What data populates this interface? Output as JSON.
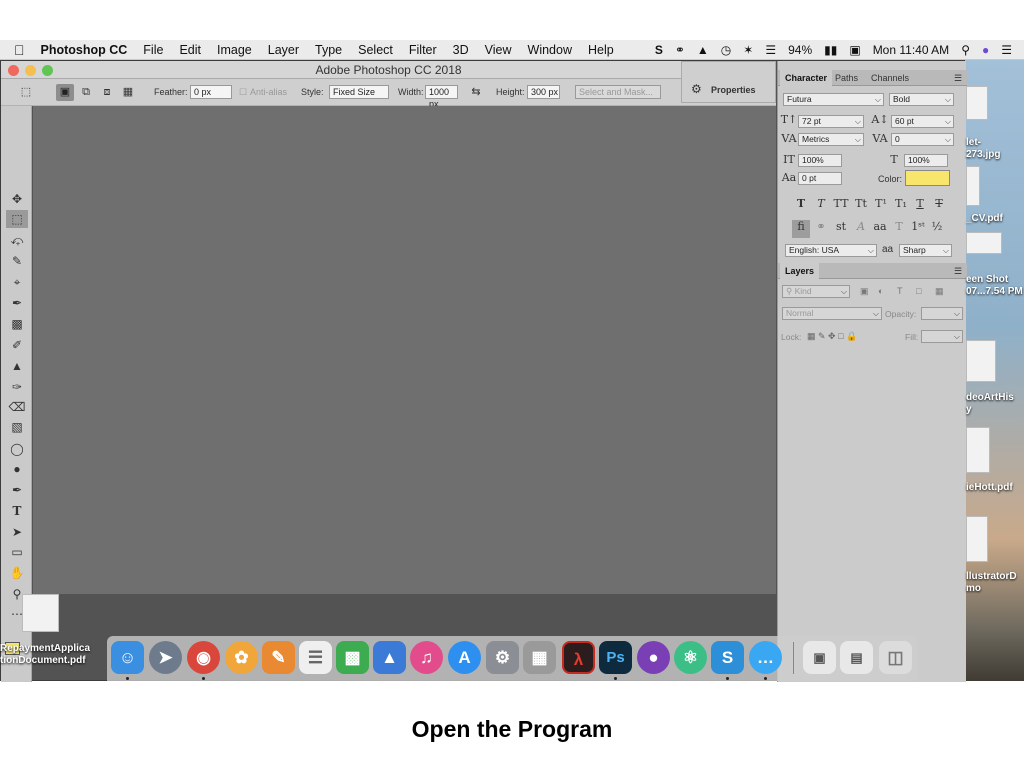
{
  "menubar": {
    "app_name": "Photoshop CC",
    "items": [
      "File",
      "Edit",
      "Image",
      "Layer",
      "Type",
      "Select",
      "Filter",
      "3D",
      "View",
      "Window",
      "Help"
    ],
    "battery": "94%",
    "clock": "Mon 11:40 AM"
  },
  "window": {
    "title": "Adobe Photoshop CC 2018"
  },
  "options_bar": {
    "feather_label": "Feather:",
    "feather_value": "0 px",
    "antialias_label": "Anti-alias",
    "style_label": "Style:",
    "style_value": "Fixed Size",
    "width_label": "Width:",
    "width_value": "1000 px",
    "height_label": "Height:",
    "height_value": "300 px",
    "select_mask_label": "Select and Mask..."
  },
  "properties_panel": {
    "label": "Properties"
  },
  "character_panel": {
    "tabs": [
      "Character",
      "Paths",
      "Channels"
    ],
    "font_family": "Futura",
    "font_style": "Bold",
    "font_size": "72 pt",
    "leading": "60 pt",
    "kerning": "Metrics",
    "tracking": "0",
    "vertical_scale": "100%",
    "horizontal_scale": "100%",
    "baseline_shift": "0 pt",
    "color_label": "Color:",
    "color_swatch": "#f7e66b",
    "language": "English: USA",
    "antialias_glyph": "aa",
    "antialias": "Sharp"
  },
  "layers_panel": {
    "tab": "Layers",
    "filter_placeholder": "Kind",
    "blend_mode": "Normal",
    "opacity_label": "Opacity:",
    "lock_label": "Lock:",
    "fill_label": "Fill:"
  },
  "desktop_files": [
    {
      "label_line1": "let-",
      "label_line2": "273.jpg"
    },
    {
      "label_line1": "_CV.pdf",
      "label_line2": ""
    },
    {
      "label_line1": "een Shot",
      "label_line2": "07...7.54 PM"
    },
    {
      "label_line1": "deoArtHis",
      "label_line2": "y"
    },
    {
      "label_line1": "ieHott.pdf",
      "label_line2": ""
    },
    {
      "label_line1": "llustratorD",
      "label_line2": "mo"
    },
    {
      "label_line1": "RepaymentApplica",
      "label_line2": "tionDocument.pdf"
    }
  ],
  "caption": "Open the Program"
}
